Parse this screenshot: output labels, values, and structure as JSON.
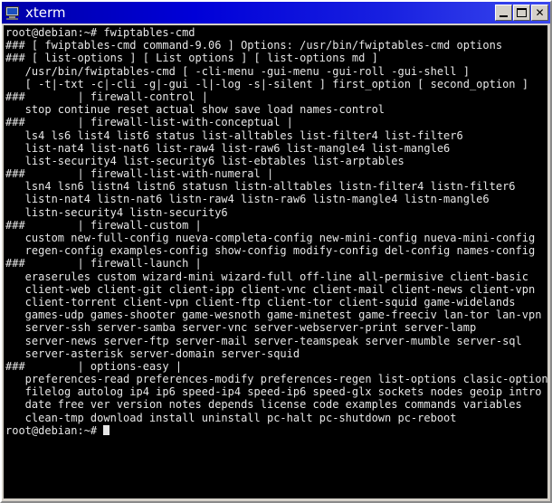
{
  "window": {
    "title": "xterm",
    "icon": "computer-monitor-icon",
    "buttons": {
      "minimize": "_",
      "maximize": "□",
      "close": "✕"
    },
    "colors": {
      "titlebar_start": "#0000a8",
      "titlebar_end": "#3a48ee",
      "frame": "#d4d0c8",
      "terminal_bg": "#000000",
      "terminal_fg": "#e6e6e6"
    }
  },
  "terminal": {
    "prompt": "root@debian:~#",
    "command": "fwiptables-cmd",
    "lines": [
      "root@debian:~# fwiptables-cmd",
      "### [ fwiptables-cmd command-9.06 ] Options: /usr/bin/fwiptables-cmd options",
      "### [ list-options ] [ List options ] [ list-options md ]",
      "   /usr/bin/fwiptables-cmd [ -cli-menu -gui-menu -gui-roll -gui-shell ]",
      "   [ -t|-txt -c|-cli -g|-gui -l|-log -s|-silent ] first_option [ second_option ]",
      "###        | firewall-control |",
      "   stop continue reset actual show save load names-control",
      "###        | firewall-list-with-conceptual |",
      "   ls4 ls6 list4 list6 status list-alltables list-filter4 list-filter6",
      "   list-nat4 list-nat6 list-raw4 list-raw6 list-mangle4 list-mangle6",
      "   list-security4 list-security6 list-ebtables list-arptables",
      "###        | firewall-list-with-numeral |",
      "   lsn4 lsn6 listn4 listn6 statusn listn-alltables listn-filter4 listn-filter6",
      "   listn-nat4 listn-nat6 listn-raw4 listn-raw6 listn-mangle4 listn-mangle6",
      "   listn-security4 listn-security6",
      "###        | firewall-custom |",
      "   custom new-full-config nueva-completa-config new-mini-config nueva-mini-config",
      "   regen-config examples-config show-config modify-config del-config names-config",
      "###        | firewall-launch |",
      "   eraserules custom wizard-mini wizard-full off-line all-permisive client-basic",
      "   client-web client-git client-ipp client-vnc client-mail client-news client-vpn",
      "   client-torrent client-vpn client-ftp client-tor client-squid game-widelands",
      "   games-udp games-shooter game-wesnoth game-minetest game-freeciv lan-tor lan-vpn",
      "   server-ssh server-samba server-vnc server-webserver-print server-lamp",
      "   server-news server-ftp server-mail server-teamspeak server-mumble server-sql",
      "   server-asterisk server-domain server-squid",
      "###        | options-easy |",
      "   preferences-read preferences-modify preferences-regen list-options clasic-options",
      "   filelog autolog ip4 ip6 speed-ip4 speed-ip6 speed-glx sockets nodes geoip intro",
      "   date free ver version notes depends license code examples commands variables",
      "   clean-tmp download install uninstall pc-halt pc-shutdown pc-reboot"
    ],
    "final_prompt": "root@debian:~# "
  }
}
